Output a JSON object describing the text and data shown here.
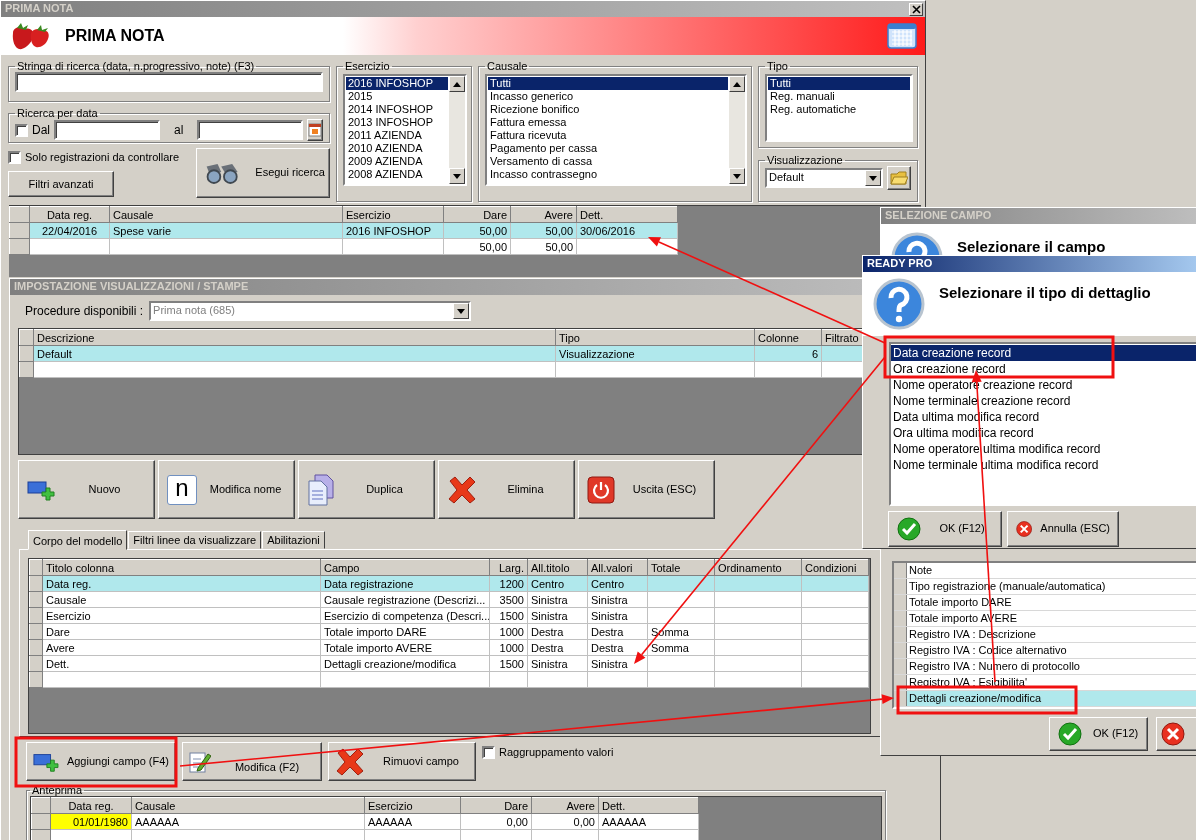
{
  "main_window": {
    "title": "PRIMA NOTA",
    "header_title": "PRIMA NOTA",
    "search": {
      "label": "Stringa di ricerca (data, n.progressivo, note) (F3)"
    },
    "date_search": {
      "label": "Ricerca per data",
      "from_label": "Dal",
      "from_checked": false,
      "to_label": "al"
    },
    "only_to_check": {
      "label": "Solo registrazioni da controllare",
      "checked": false
    },
    "advanced_filters_button": "Filtri avanzati",
    "search_button": "Esegui ricerca",
    "esercizio": {
      "label": "Esercizio",
      "items": [
        {
          "text": "2016 INFOSHOP",
          "selected": true
        },
        {
          "text": "2015",
          "selected": false
        },
        {
          "text": "2014 INFOSHOP",
          "selected": false
        },
        {
          "text": "2013 INFOSHOP",
          "selected": false
        },
        {
          "text": "2011 AZIENDA",
          "selected": false
        },
        {
          "text": "2010 AZIENDA",
          "selected": false
        },
        {
          "text": "2009 AZIENDA",
          "selected": false
        },
        {
          "text": "2008 AZIENDA",
          "selected": false
        }
      ]
    },
    "causale": {
      "label": "Causale",
      "items": [
        {
          "text": "Tutti",
          "selected": true
        },
        {
          "text": "Incasso generico",
          "selected": false
        },
        {
          "text": "Ricezione bonifico",
          "selected": false
        },
        {
          "text": "Fattura emessa",
          "selected": false
        },
        {
          "text": "Fattura ricevuta",
          "selected": false
        },
        {
          "text": "Pagamento per cassa",
          "selected": false
        },
        {
          "text": "Versamento di cassa",
          "selected": false
        },
        {
          "text": "Incasso contrassegno",
          "selected": false
        }
      ]
    },
    "tipo": {
      "label": "Tipo",
      "items": [
        {
          "text": "Tutti",
          "selected": true
        },
        {
          "text": "Reg. manuali",
          "selected": false
        },
        {
          "text": "Reg. automatiche",
          "selected": false
        }
      ]
    },
    "visualizzazione": {
      "label": "Visualizzazione",
      "value": "Default"
    },
    "results": {
      "columns": [
        "Data reg.",
        "Causale",
        "Esercizio",
        "Dare",
        "Avere",
        "Dett."
      ],
      "rows": [
        {
          "data_reg": "22/04/2016",
          "causale": "Spese varie",
          "esercizio": "2016 INFOSHOP",
          "dare": "50,00",
          "avere": "50,00",
          "dett": "30/06/2016",
          "selected": true
        },
        {
          "dare": "50,00",
          "avere": "50,00",
          "selected": false
        }
      ]
    }
  },
  "settings_window": {
    "title": "IMPOSTAZIONE VISUALIZZAZIONI / STAMPE",
    "procedure_label": "Procedure disponibili :",
    "procedure_value": "Prima nota (685)",
    "models": {
      "columns": [
        "Descrizione",
        "Tipo",
        "Colonne",
        "Filtrato"
      ],
      "rows": [
        {
          "descrizione": "Default",
          "tipo": "Visualizzazione",
          "colonne": "6",
          "selected": true
        }
      ]
    },
    "buttons": [
      {
        "label": "Nuovo",
        "kind": "add"
      },
      {
        "label": "Modifica nome",
        "kind": "rename",
        "glyph": "n"
      },
      {
        "label": "Duplica",
        "kind": "copy"
      },
      {
        "label": "Elimina",
        "kind": "delete"
      },
      {
        "label": "Uscita (ESC)",
        "kind": "exit"
      }
    ],
    "tabs": [
      {
        "label": "Corpo del modello",
        "selected": true
      },
      {
        "label": "Filtri linee da visualizzare",
        "selected": false
      },
      {
        "label": "Abilitazioni",
        "selected": false
      }
    ],
    "fields": {
      "columns": [
        "Titolo colonna",
        "Campo",
        "Larg.",
        "All.titolo",
        "All.valori",
        "Totale",
        "Ordinamento",
        "Condizioni"
      ],
      "rows": [
        {
          "titolo_colonna": "Data reg.",
          "campo": "Data registrazione",
          "larg": "1200",
          "all_titolo": "Centro",
          "all_valori": "Centro",
          "selected": true
        },
        {
          "titolo_colonna": "Causale",
          "campo": "Causale registrazione (Descrizi...",
          "larg": "3500",
          "all_titolo": "Sinistra",
          "all_valori": "Sinistra",
          "selected": false
        },
        {
          "titolo_colonna": "Esercizio",
          "campo": "Esercizio di competenza (Descri...",
          "larg": "1500",
          "all_titolo": "Sinistra",
          "all_valori": "Sinistra",
          "selected": false
        },
        {
          "titolo_colonna": "Dare",
          "campo": "Totale importo DARE",
          "larg": "1000",
          "all_titolo": "Destra",
          "all_valori": "Destra",
          "totale": "Somma",
          "selected": false
        },
        {
          "titolo_colonna": "Avere",
          "campo": "Totale importo AVERE",
          "larg": "1000",
          "all_titolo": "Destra",
          "all_valori": "Destra",
          "totale": "Somma",
          "selected": false
        },
        {
          "titolo_colonna": "Dett.",
          "campo": "Dettagli creazione/modifica",
          "larg": "1500",
          "all_titolo": "Sinistra",
          "all_valori": "Sinistra",
          "selected": false
        }
      ]
    },
    "field_buttons": [
      {
        "label": "Aggiungi campo (F4)",
        "kind": "add"
      },
      {
        "label": "Modifica (F2)",
        "kind": "edit"
      },
      {
        "label": "Rimuovi campo",
        "kind": "delete"
      }
    ],
    "grouping": {
      "label": "Raggruppamento valori",
      "checked": false
    },
    "preview": {
      "label": "Anteprima",
      "columns": [
        "Data reg.",
        "Causale",
        "Esercizio",
        "Dare",
        "Avere",
        "Dett."
      ],
      "rows": [
        {
          "data_reg": "01/01/1980",
          "causale": "AAAAAA",
          "esercizio": "AAAAAA",
          "dare": "0,00",
          "avere": "0,00",
          "dett": "AAAAAA"
        }
      ]
    }
  },
  "field_dialog": {
    "title": "SELEZIONE CAMPO",
    "prompt": "Selezionare il campo",
    "items": [
      {
        "text": "Note",
        "selected": false
      },
      {
        "text": "Tipo registrazione (manuale/automatica)",
        "selected": false
      },
      {
        "text": "Totale importo DARE",
        "selected": false
      },
      {
        "text": "Totale importo AVERE",
        "selected": false
      },
      {
        "text": "Registro IVA : Descrizione",
        "selected": false
      },
      {
        "text": "Registro IVA : Codice alternativo",
        "selected": false
      },
      {
        "text": "Registro IVA : Numero di protocollo",
        "selected": false
      },
      {
        "text": "Registro IVA : Esigibilita'",
        "selected": false
      },
      {
        "text": "Dettagli creazione/modifica",
        "selected": true
      }
    ],
    "ok_button": "OK (F12)"
  },
  "detail_dialog": {
    "title": "READY PRO",
    "prompt": "Selezionare il tipo di dettaglio",
    "items": [
      {
        "text": "Data creazione record",
        "selected": true
      },
      {
        "text": "Ora creazione record",
        "selected": false
      },
      {
        "text": "Nome operatore creazione record",
        "selected": false
      },
      {
        "text": "Nome terminale creazione record",
        "selected": false
      },
      {
        "text": "Data ultima modifica record",
        "selected": false
      },
      {
        "text": "Ora ultima modifica record",
        "selected": false
      },
      {
        "text": "Nome operatore ultima modifica record",
        "selected": false
      },
      {
        "text": "Nome terminale ultima modifica record",
        "selected": false
      }
    ],
    "ok_button": "OK (F12)",
    "cancel_button": "Annulla (ESC)"
  }
}
